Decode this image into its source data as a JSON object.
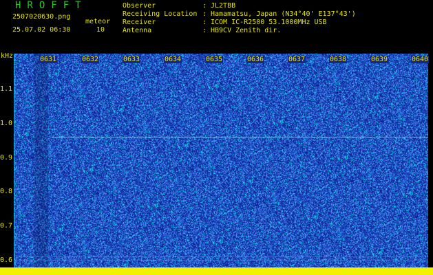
{
  "header": {
    "brand": "HROFFT",
    "filename": "2507020630.png",
    "datetime": "25.07.02 06:30",
    "meteor_label": "meteor",
    "meteor_count": "10",
    "info": [
      {
        "key": "Observer",
        "value": "JL2TBB"
      },
      {
        "key": "Receiving Location",
        "value": "Hamamatsu, Japan (N34°40' E137°43')"
      },
      {
        "key": "Receiver",
        "value": "ICOM IC-R2500 53.1000MHz USB"
      },
      {
        "key": "Antenna",
        "value": "HB9CV Zenith dir."
      }
    ]
  },
  "plot": {
    "y_unit": "kHz",
    "y_ticks": [
      "1.1",
      "1.0",
      "0.9",
      "0.8",
      "0.7",
      "0.6"
    ],
    "time_ticks": [
      "0631",
      "0632",
      "0633",
      "0634",
      "0635",
      "0636",
      "0637",
      "0638",
      "0639",
      "0640"
    ],
    "colors": {
      "background": "#1a3aa8",
      "noise_light": "#40b0ff",
      "noise_cyan": "#00ffee",
      "axis": "#e6e600",
      "trace": "#66ff99"
    }
  }
}
